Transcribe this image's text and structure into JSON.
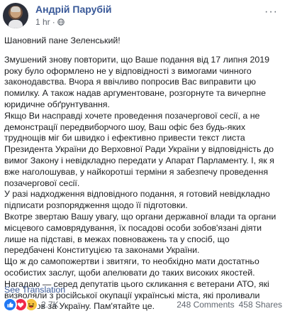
{
  "post": {
    "author": "Андрій Парубій",
    "time": "1 hr",
    "time_sep": "·",
    "greeting": "Шановний пане Зеленський!",
    "paragraphs": [
      "Змушений знову повторити, що Ваше подання від 17 липня 2019 року було оформлено не у відповідності з вимогами чинного законодавства. Вчора я ввічливо попросив Вас виправити цю помилку. А також надав аргументоване, розгорнуте та вичерпне юридичне обґрунтування.",
      "Якщо Ви насправді хочете проведення позачергової сесії, а не демонстрації передвиборчого шоу, Ваш офіс без будь-яких труднощів міг би швидко і ефективно привести текст листа Президента України до Верховної Ради України у відповідність до вимог Закону і невідкладно передати у Апарат Парламенту. І, як я вже наголошував, у найкоротші терміни я забезпечу проведення позачергової сесії.",
      "У разі надходження відповідного подання, я готовий невідкладно підписати розпорядження щодо її підготовки.",
      "Вкотре звертаю Вашу увагу, що органи державної влади та органи місцевого самоврядування, їх посадові особи зобов'язані діяти лише на підставі, в межах повноважень та у спосіб, що передбачені Конституцією та законами України.",
      "Що ж до самопожертви і звитяги, то необхідно мати достатньо особистих заслуг, щоби апелювати до таких високих якостей. Нагадаю — серед депутатів цього скликання є ветерани АТО, які визволяли з російської окупації українські міста, які проливали свою кров за Україну. Пам'ятайте це."
    ],
    "see_translation": "See Translation"
  },
  "footer": {
    "reactions_count": "2.7K",
    "reactions": [
      "like",
      "love",
      "haha"
    ],
    "comments": "248 Comments",
    "shares": "458 Shares"
  },
  "colors": {
    "link": "#385898",
    "text": "#1c1e21",
    "muted": "#606770",
    "like": "#2078f4",
    "love": "#f0284a",
    "haha": "#f7c440"
  }
}
